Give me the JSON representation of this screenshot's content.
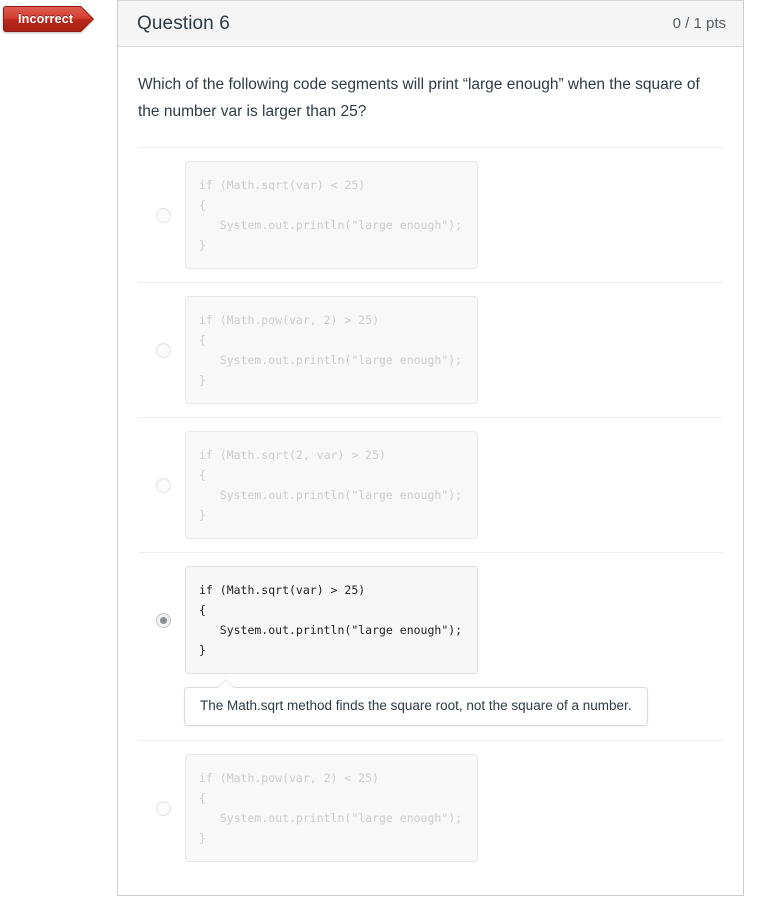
{
  "header": {
    "status_badge": "Incorrect",
    "question_name": "Question 6",
    "points": "0 / 1 pts"
  },
  "question": {
    "text": "Which of the following code segments will print “large enough” when the square of the number var is larger than 25?"
  },
  "answers": [
    {
      "id": "answer-1",
      "selected": false,
      "code": "if (Math.sqrt(var) < 25)\n{\n   System.out.println(\"large enough\");\n}"
    },
    {
      "id": "answer-2",
      "selected": false,
      "code": "if (Math.pow(var, 2) > 25)\n{\n   System.out.println(\"large enough\");\n}"
    },
    {
      "id": "answer-3",
      "selected": false,
      "code": "if (Math.sqrt(2, var) > 25)\n{\n   System.out.println(\"large enough\");\n}"
    },
    {
      "id": "answer-4",
      "selected": true,
      "code": "if (Math.sqrt(var) > 25)\n{\n   System.out.println(\"large enough\");\n}"
    },
    {
      "id": "answer-5",
      "selected": false,
      "code": "if (Math.pow(var, 2) < 25)\n{\n   System.out.println(\"large enough\");\n}"
    }
  ],
  "feedback": {
    "text": "The Math.sqrt method finds the square root, not the square of a number."
  },
  "colors": {
    "incorrect_red": "#bb291c",
    "text_dark": "#2d3b45",
    "code_muted": "#cccccc",
    "border": "#c7cdd1"
  }
}
